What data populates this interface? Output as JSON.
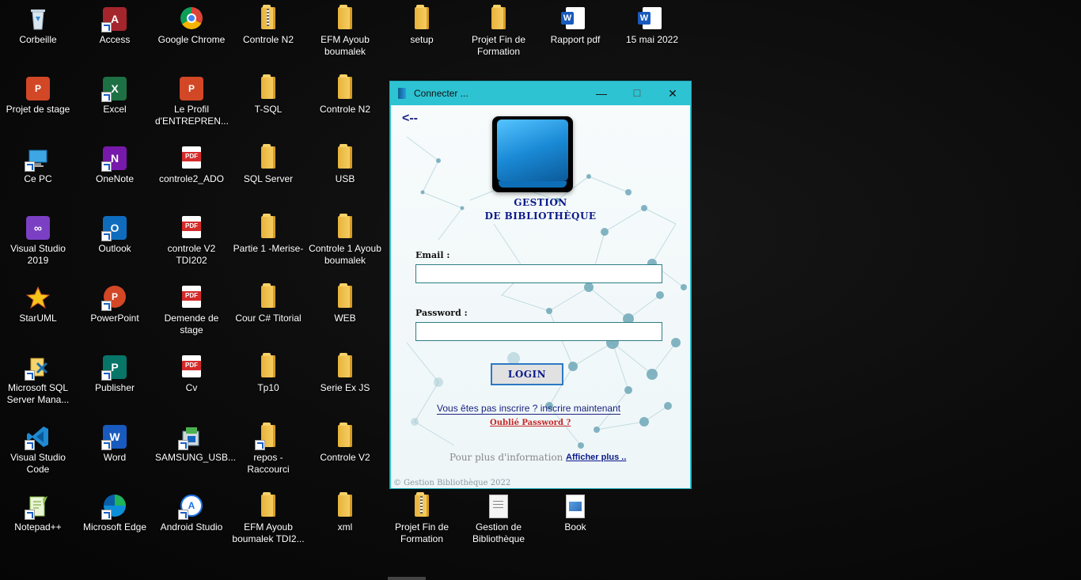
{
  "desktop": {
    "icons": [
      {
        "label": "Corbeille",
        "icon": "recycle-bin-icon"
      },
      {
        "label": "Access",
        "icon": "access-icon"
      },
      {
        "label": "Google Chrome",
        "icon": "chrome-icon"
      },
      {
        "label": "Controle N2",
        "icon": "zip-folder-icon"
      },
      {
        "label": "EFM Ayoub boumalek",
        "icon": "folder-icon"
      },
      {
        "label": "setup",
        "icon": "folder-icon"
      },
      {
        "label": "Projet Fin de Formation",
        "icon": "folder-icon"
      },
      {
        "label": "Rapport pdf",
        "icon": "word-doc-icon"
      },
      {
        "label": "15 mai 2022",
        "icon": "word-doc-icon"
      },
      {
        "label": "Projet de stage",
        "icon": "powerpoint-file-icon"
      },
      {
        "label": "Excel",
        "icon": "excel-icon"
      },
      {
        "label": "Le Profil d'ENTREPREN...",
        "icon": "powerpoint-file-icon"
      },
      {
        "label": "T-SQL",
        "icon": "folder-icon"
      },
      {
        "label": "Controle N2",
        "icon": "folder-icon"
      },
      {
        "label": "Ce PC",
        "icon": "computer-icon"
      },
      {
        "label": "OneNote",
        "icon": "onenote-icon"
      },
      {
        "label": "controle2_ADO",
        "icon": "pdf-icon"
      },
      {
        "label": "SQL Server",
        "icon": "folder-icon"
      },
      {
        "label": "USB",
        "icon": "folder-icon"
      },
      {
        "label": "Visual Studio 2019",
        "icon": "visual-studio-icon"
      },
      {
        "label": "Outlook",
        "icon": "outlook-icon"
      },
      {
        "label": "controle V2 TDI202",
        "icon": "pdf-icon"
      },
      {
        "label": "Partie 1 -Merise-",
        "icon": "folder-icon"
      },
      {
        "label": "Controle 1 Ayoub boumalek",
        "icon": "folder-icon"
      },
      {
        "label": "StarUML",
        "icon": "staruml-icon"
      },
      {
        "label": "PowerPoint",
        "icon": "powerpoint-icon"
      },
      {
        "label": "Demende de stage",
        "icon": "pdf-icon"
      },
      {
        "label": "Cour C# Titorial",
        "icon": "folder-icon"
      },
      {
        "label": "WEB",
        "icon": "folder-icon"
      },
      {
        "label": "Microsoft SQL Server Mana...",
        "icon": "ssms-icon"
      },
      {
        "label": "Publisher",
        "icon": "publisher-icon"
      },
      {
        "label": "Cv",
        "icon": "pdf-icon"
      },
      {
        "label": "Tp10",
        "icon": "folder-icon"
      },
      {
        "label": "Serie Ex JS",
        "icon": "folder-icon"
      },
      {
        "label": "Visual Studio Code",
        "icon": "vscode-icon"
      },
      {
        "label": "Word",
        "icon": "word-icon"
      },
      {
        "label": "SAMSUNG_USB...",
        "icon": "installer-icon"
      },
      {
        "label": "repos - Raccourci",
        "icon": "folder-icon"
      },
      {
        "label": "Controle V2",
        "icon": "folder-icon"
      },
      {
        "label": "Notepad++",
        "icon": "notepadpp-icon"
      },
      {
        "label": "Microsoft Edge",
        "icon": "edge-icon"
      },
      {
        "label": "Android Studio",
        "icon": "android-studio-icon"
      },
      {
        "label": "EFM Ayoub boumalek TDI2...",
        "icon": "folder-icon"
      },
      {
        "label": "xml",
        "icon": "folder-icon"
      },
      {
        "label": "Projet Fin de Formation",
        "icon": "zip-folder-icon"
      },
      {
        "label": "Gestion de Bibliothèque",
        "icon": "text-file-icon"
      },
      {
        "label": "Book",
        "icon": "image-file-icon"
      }
    ]
  },
  "login_window": {
    "title": "Connecter ...",
    "controls": {
      "minimize": "—",
      "maximize": "☐",
      "close": "✕"
    },
    "back_arrow": "<--",
    "logo_title_line1": "GESTION",
    "logo_title_line2": "DE BIBLIOTHÈQUE",
    "email_label": "Email :",
    "email_value": "",
    "password_label": "Password :",
    "password_value": "",
    "login_button": "LOGIN",
    "signup_link": "Vous êtes pas inscrire ? inscrire maintenant",
    "forgot_link": "Oublié Password ?",
    "info_text": "Pour plus d'information",
    "more_link": "Afficher plus ..",
    "copyright": "© Gestion Bibliothèque 2022"
  },
  "colors": {
    "titlebar": "#2ec3d3",
    "link_blue": "#1a237e",
    "forgot_red": "#c62828"
  }
}
